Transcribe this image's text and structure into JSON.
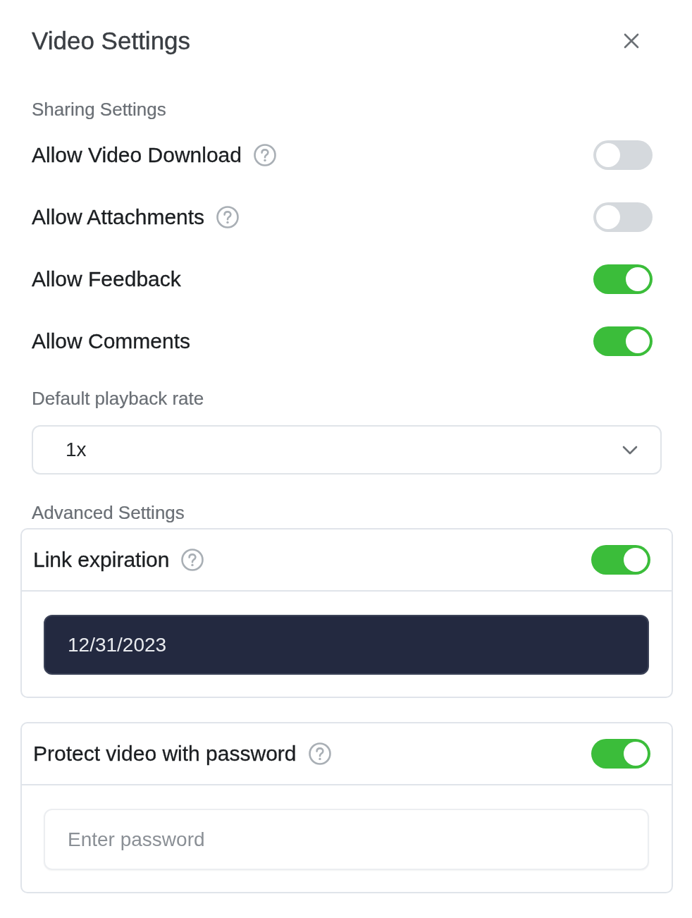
{
  "header": {
    "title": "Video Settings"
  },
  "sharing": {
    "heading": "Sharing Settings",
    "options": [
      {
        "label": "Allow Video Download",
        "help": true,
        "on": false
      },
      {
        "label": "Allow Attachments",
        "help": true,
        "on": false
      },
      {
        "label": "Allow Feedback",
        "help": false,
        "on": true
      },
      {
        "label": "Allow Comments",
        "help": false,
        "on": true
      }
    ]
  },
  "playback_rate": {
    "label": "Default playback rate",
    "value": "1x"
  },
  "advanced": {
    "heading": "Advanced Settings",
    "cards": [
      {
        "kind": "date",
        "label": "Link expiration",
        "help": true,
        "on": true,
        "value": "12/31/2023"
      },
      {
        "kind": "password",
        "label": "Protect video with password",
        "help": true,
        "on": true,
        "placeholder": "Enter password"
      }
    ]
  }
}
